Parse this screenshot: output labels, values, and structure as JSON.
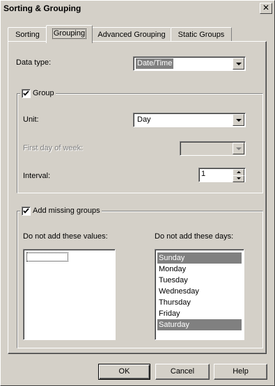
{
  "window": {
    "title": "Sorting & Grouping",
    "close_glyph": "✕"
  },
  "tabs": [
    {
      "label": "Sorting"
    },
    {
      "label": "Grouping"
    },
    {
      "label": "Advanced Grouping"
    },
    {
      "label": "Static Groups"
    }
  ],
  "data_type": {
    "label": "Data type:",
    "value": "Date/Time"
  },
  "group": {
    "legend": "Group",
    "checked": true,
    "unit_label": "Unit:",
    "unit_value": "Day",
    "first_day_label": "First day of week:",
    "first_day_value": "",
    "interval_label": "Interval:",
    "interval_value": "1"
  },
  "missing": {
    "legend": "Add missing groups",
    "checked": true,
    "values_label": "Do not add these values:",
    "days_label": "Do not add these days:",
    "days": [
      {
        "label": "Sunday",
        "selected": true
      },
      {
        "label": "Monday",
        "selected": false
      },
      {
        "label": "Tuesday",
        "selected": false
      },
      {
        "label": "Wednesday",
        "selected": false
      },
      {
        "label": "Thursday",
        "selected": false
      },
      {
        "label": "Friday",
        "selected": false
      },
      {
        "label": "Saturday",
        "selected": true
      }
    ]
  },
  "buttons": {
    "ok": "OK",
    "cancel": "Cancel",
    "help": "Help"
  },
  "colors": {
    "face": "#d4d0c8",
    "selection": "#808080",
    "disabled_text": "#808080"
  }
}
